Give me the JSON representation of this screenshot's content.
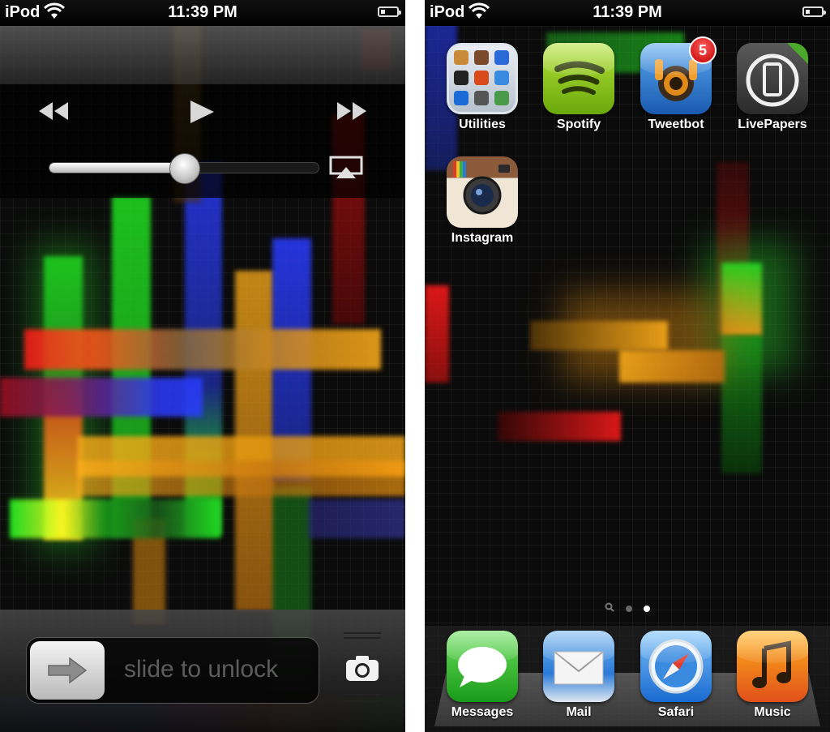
{
  "status": {
    "carrier": "iPod",
    "time": "11:39 PM",
    "battery_level": 0.3
  },
  "lock_screen": {
    "controls": {
      "rewind_icon": "rewind-icon",
      "play_icon": "play-icon",
      "fast_forward_icon": "fast-forward-icon",
      "airplay_icon": "airplay-icon"
    },
    "volume_level": 0.5,
    "slider_text": "slide to unlock",
    "camera_icon": "camera-icon"
  },
  "home_screen": {
    "apps": [
      {
        "label": "Utilities",
        "icon": "utilities-folder-icon"
      },
      {
        "label": "Spotify",
        "icon": "spotify-icon"
      },
      {
        "label": "Tweetbot",
        "icon": "tweetbot-icon",
        "badge": "5"
      },
      {
        "label": "LivePapers",
        "icon": "livepapers-icon"
      },
      {
        "label": "Instagram",
        "icon": "instagram-icon"
      }
    ],
    "page_dots": {
      "count": 2,
      "active": 1
    },
    "dock": [
      {
        "label": "Messages",
        "icon": "messages-icon"
      },
      {
        "label": "Mail",
        "icon": "mail-icon"
      },
      {
        "label": "Safari",
        "icon": "safari-icon"
      },
      {
        "label": "Music",
        "icon": "music-icon"
      }
    ]
  },
  "colors": {
    "badge": "#d40000",
    "wallpaper_red": "#ff1a1a",
    "wallpaper_green": "#22e022",
    "wallpaper_blue": "#2a3cff",
    "wallpaper_orange": "#ffae1a"
  }
}
